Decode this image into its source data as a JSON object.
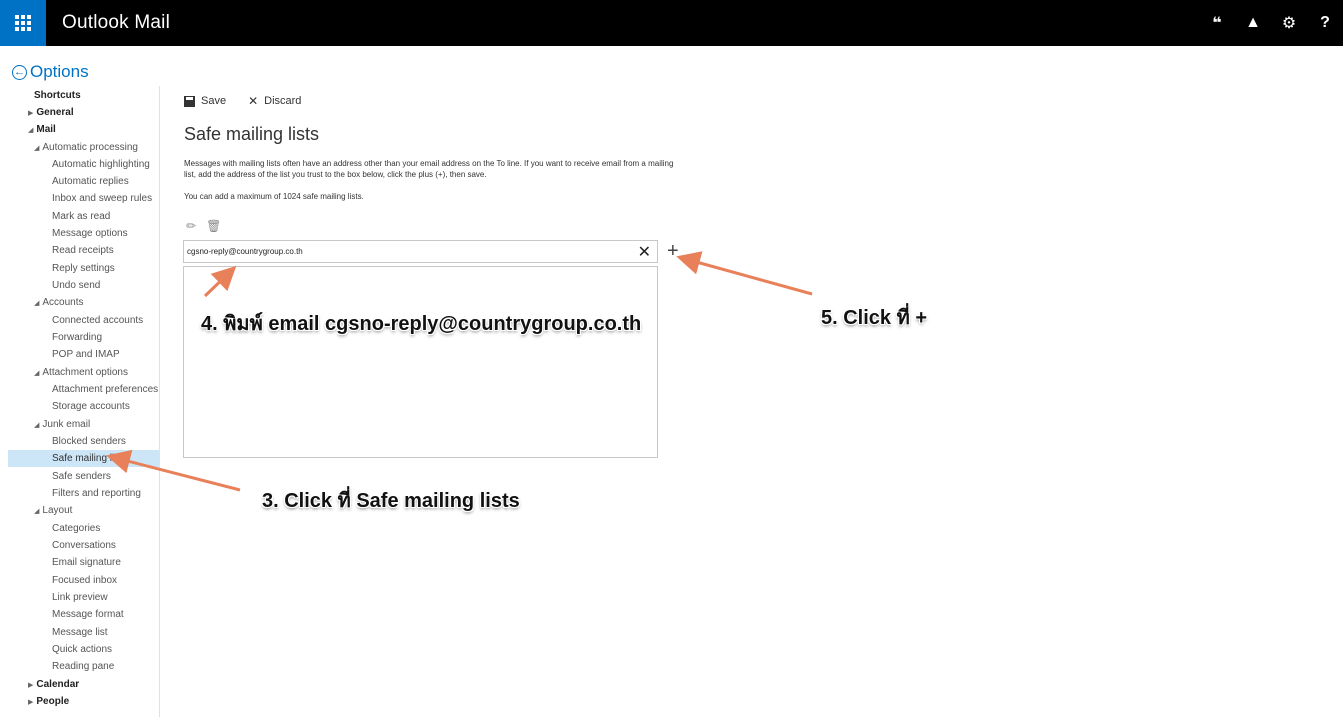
{
  "app": {
    "title": "Outlook Mail"
  },
  "topbar": {
    "icons": [
      {
        "name": "feedback-icon",
        "glyph": "❝"
      },
      {
        "name": "bell-icon",
        "glyph": "▲"
      },
      {
        "name": "gear-icon",
        "glyph": "⚙"
      },
      {
        "name": "help-icon",
        "glyph": "?"
      }
    ]
  },
  "options": {
    "label": "Options"
  },
  "sidebar": {
    "shortcuts": "Shortcuts",
    "general": "General",
    "mail": "Mail",
    "automatic_processing": "Automatic processing",
    "automatic_highlighting": "Automatic highlighting",
    "automatic_replies": "Automatic replies",
    "inbox_sweep_rules": "Inbox and sweep rules",
    "mark_as_read": "Mark as read",
    "message_options": "Message options",
    "read_receipts": "Read receipts",
    "reply_settings": "Reply settings",
    "undo_send": "Undo send",
    "accounts": "Accounts",
    "connected_accounts": "Connected accounts",
    "forwarding": "Forwarding",
    "pop_imap": "POP and IMAP",
    "attachment_options": "Attachment options",
    "attachment_preferences": "Attachment preferences",
    "storage_accounts": "Storage accounts",
    "junk_email": "Junk email",
    "blocked_senders": "Blocked senders",
    "safe_mailing_lists": "Safe mailing lists",
    "safe_senders": "Safe senders",
    "filters_reporting": "Filters and reporting",
    "layout": "Layout",
    "categories": "Categories",
    "conversations": "Conversations",
    "email_signature": "Email signature",
    "focused_inbox": "Focused inbox",
    "link_preview": "Link preview",
    "message_format": "Message format",
    "message_list": "Message list",
    "quick_actions": "Quick actions",
    "reading_pane": "Reading pane",
    "calendar": "Calendar",
    "people": "People"
  },
  "toolbar": {
    "save_label": "Save",
    "discard_label": "Discard"
  },
  "main": {
    "title": "Safe mailing lists",
    "description": "Messages with mailing lists often have an address other than your email address on the To line. If you want to receive email from a mailing list, add the address of the list you trust to the box below, click the plus (+), then save.",
    "max_note": "You can add a maximum of 1024 safe mailing lists.",
    "input_value": "cgsno-reply@countrygroup.co.th"
  },
  "annotations": {
    "step3": "3. Click ที่ Safe mailing lists",
    "step4": "4. พิมพ์ email cgsno-reply@countrygroup.co.th",
    "step5": "5. Click ที่ +"
  },
  "colors": {
    "accent": "#0072c6",
    "selected_bg": "#cde6f7",
    "arrow": "#e8805a"
  }
}
